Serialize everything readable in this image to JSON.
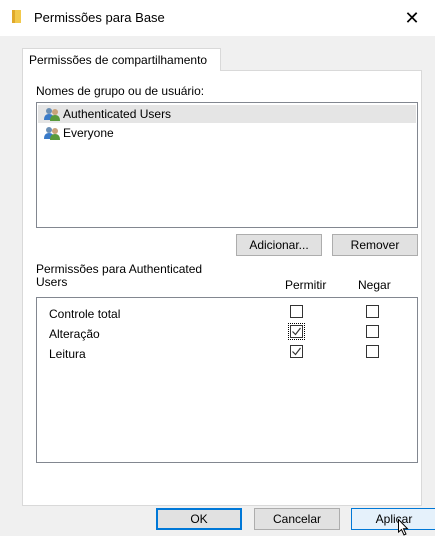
{
  "window": {
    "title": "Permissões para Base",
    "close_glyph": "✕",
    "icon": "folder-icon"
  },
  "tabs": [
    {
      "label": "Permissões de compartilhamento",
      "active": true
    }
  ],
  "group_section": {
    "label": "Nomes de grupo ou de usuário:",
    "users": [
      {
        "name": "Authenticated Users",
        "selected": true,
        "icon": "users-icon"
      },
      {
        "name": "Everyone",
        "selected": false,
        "icon": "users-icon"
      }
    ],
    "add_button": "Adicionar...",
    "remove_button": "Remover"
  },
  "permissions": {
    "label": "Permissões para Authenticated Users",
    "label_line1": "Permissões para Authenticated",
    "label_line2": "Users",
    "allow_header": "Permitir",
    "deny_header": "Negar",
    "rows": [
      {
        "name": "Controle total",
        "allow": false,
        "deny": false
      },
      {
        "name": "Alteração",
        "allow": true,
        "deny": false
      },
      {
        "name": "Leitura",
        "allow": true,
        "deny": false
      }
    ]
  },
  "footer": {
    "ok": "OK",
    "cancel": "Cancelar",
    "apply": "Aplicar"
  },
  "colors": {
    "accent": "#0078d7",
    "dialog_bg": "#f0f0f0",
    "selected_row": "#e5e5e5",
    "folder": "#f2c94c"
  }
}
